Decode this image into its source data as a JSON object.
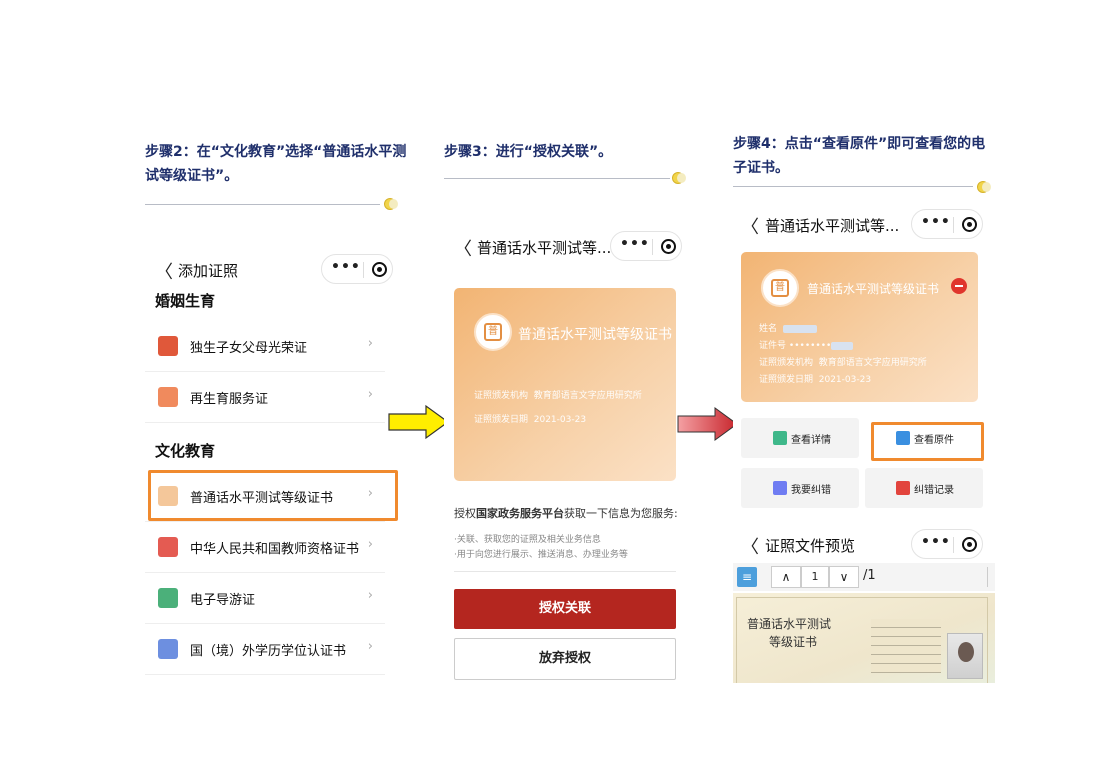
{
  "colors": {
    "step_caption": "#1f2f6b",
    "highlight": "#f08a2e",
    "primary_red": "#b4261f",
    "arrow1": "#ffee00",
    "arrow2": "#d9373d"
  },
  "step2": {
    "caption": "步骤2：在“文化教育”选择“普通话水平测试等级证书”。",
    "nav_title": "添加证照",
    "section1": "婚姻生育",
    "items1": [
      "独生子女父母光荣证",
      "再生育服务证"
    ],
    "section2": "文化教育",
    "items2": [
      "普通话水平测试等级证书",
      "中华人民共和国教师资格证书",
      "电子导游证",
      "国（境）外学历学位认证书"
    ]
  },
  "step3": {
    "caption": "步骤3：进行“授权关联”。",
    "nav_title": "普通话水平测试等...",
    "card_title": "普通话水平测试等级证书",
    "issuer_label": "证照颁发机构",
    "issuer": "教育部语言文字应用研究所",
    "date_label": "证照颁发日期",
    "date": "2021-03-23",
    "auth_pre": "授权",
    "auth_bold": "国家政务服务平台",
    "auth_post": "获取一下信息为您服务:",
    "bullets": [
      "·关联、获取您的证照及相关业务信息",
      "·用于向您进行展示、推送消息、办理业务等"
    ],
    "btn_primary": "授权关联",
    "btn_secondary": "放弃授权"
  },
  "step4": {
    "caption": "步骤4：点击“查看原件”即可查看您的电子证书。",
    "nav_title": "普通话水平测试等...",
    "card_title": "普通话水平测试等级证书",
    "name_label": "姓名",
    "id_label": "证件号",
    "id_value": "••••••••",
    "issuer_label": "证照颁发机构",
    "issuer": "教育部语言文字应用研究所",
    "date_label": "证照颁发日期",
    "date": "2021-03-23",
    "tiles": [
      "查看详情",
      "查看原件",
      "我要纠错",
      "纠错记录"
    ],
    "preview_title": "证照文件预览",
    "page_current": "1",
    "page_total": "/1",
    "cert_title": "普通话水平测试",
    "cert_subtitle": "等级证书"
  }
}
